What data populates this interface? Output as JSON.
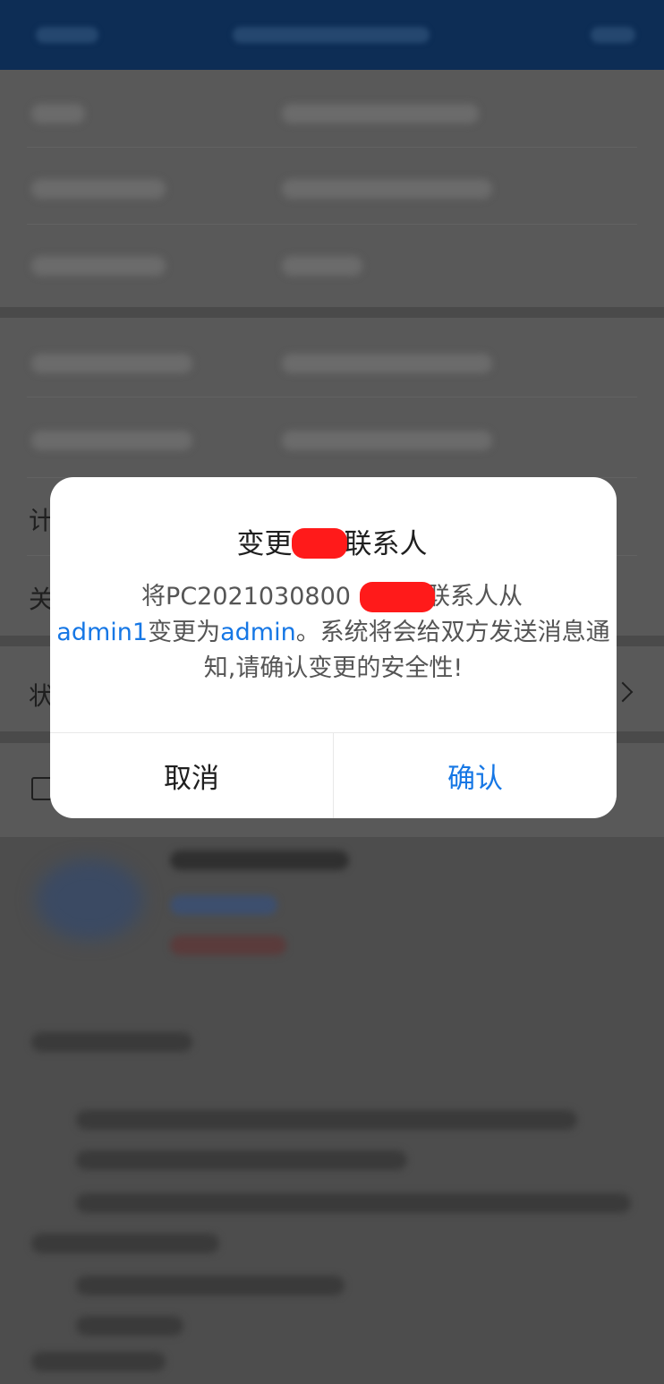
{
  "dialog": {
    "title_prefix": "变更",
    "title_suffix": "联系人",
    "body_p1": "将PC2021030800",
    "body_p2": "联系人从",
    "from_user": "admin1",
    "middle_text": "变更为",
    "to_user": "admin",
    "body_p3": "。系统将会给双方发送消息通知,请确认变更的安全性!",
    "cancel_label": "取消",
    "confirm_label": "确认"
  },
  "background": {
    "row_labels_visible": [
      "计",
      "关",
      "状"
    ]
  },
  "colors": {
    "accent": "#1677e5",
    "header": "#0d2d55",
    "redaction": "#ff1a1a"
  }
}
